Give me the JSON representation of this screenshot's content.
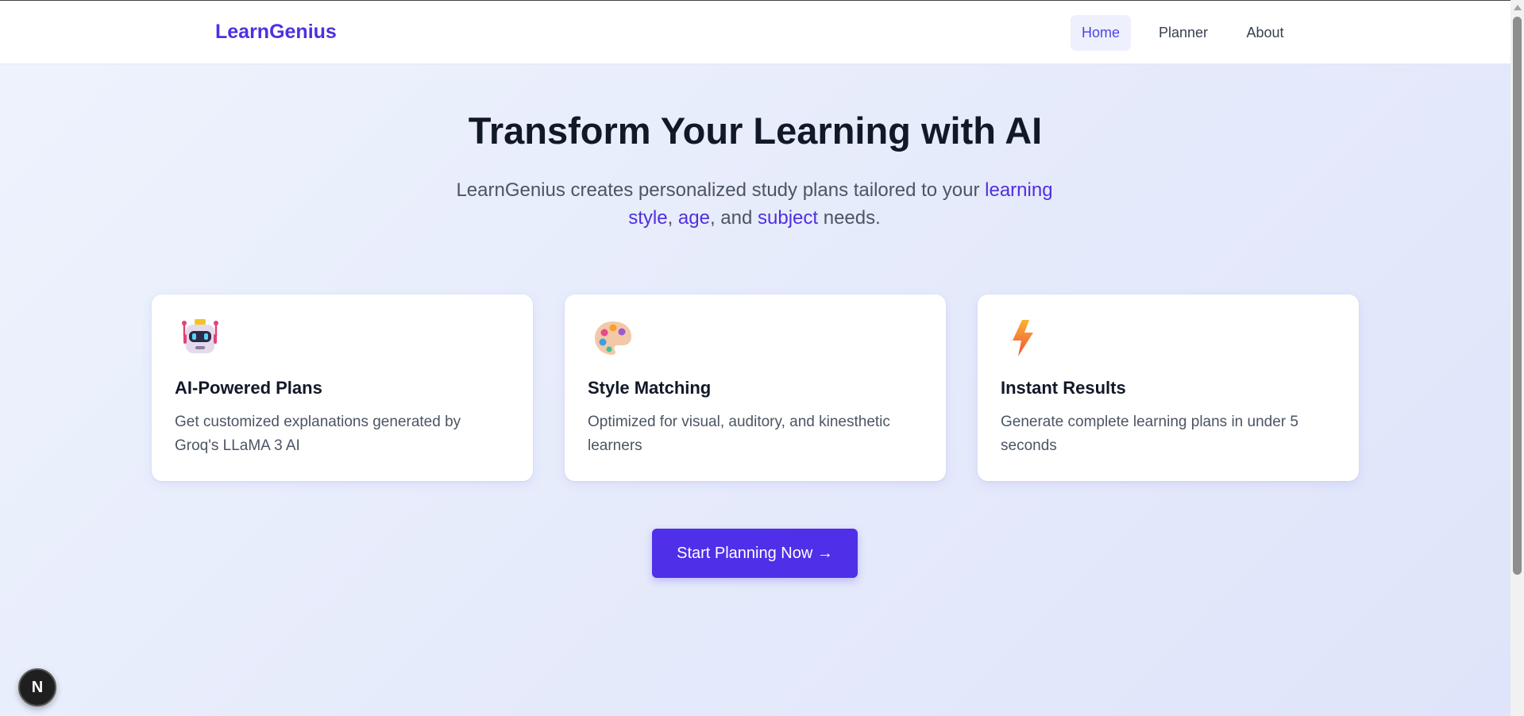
{
  "nav": {
    "brand": "LearnGenius",
    "links": [
      {
        "label": "Home",
        "active": true
      },
      {
        "label": "Planner",
        "active": false
      },
      {
        "label": "About",
        "active": false
      }
    ]
  },
  "hero": {
    "title": "Transform Your Learning with AI",
    "subtitle": {
      "prefix": "LearnGenius creates personalized study plans tailored to your ",
      "highlight1": "learning style",
      "sep1": ", ",
      "highlight2": "age",
      "sep2": ", and ",
      "highlight3": "subject",
      "suffix": " needs."
    }
  },
  "features": [
    {
      "icon": "robot-icon",
      "title": "AI-Powered Plans",
      "description": "Get customized explanations generated by Groq's LLaMA 3 AI"
    },
    {
      "icon": "palette-icon",
      "title": "Style Matching",
      "description": "Optimized for visual, auditory, and kinesthetic learners"
    },
    {
      "icon": "lightning-icon",
      "title": "Instant Results",
      "description": "Generate complete learning plans in under 5 seconds"
    }
  ],
  "cta": {
    "label": "Start Planning Now →"
  },
  "devtools": {
    "label": "N"
  },
  "colors": {
    "brand": "#4f2fe0",
    "button": "#4f2fe8",
    "active_nav_bg": "#eef0fd"
  }
}
